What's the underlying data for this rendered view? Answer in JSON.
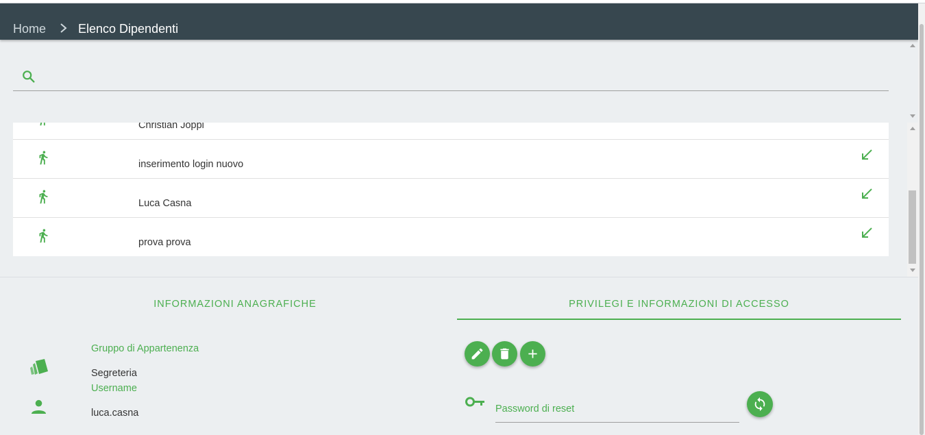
{
  "breadcrumb": {
    "home": "Home",
    "current": "Elenco Dipendenti"
  },
  "search": {
    "placeholder": ""
  },
  "employees": [
    {
      "name": "Christian Joppi"
    },
    {
      "name": "inserimento login nuovo"
    },
    {
      "name": "Luca Casna"
    },
    {
      "name": "prova prova"
    }
  ],
  "tabs": {
    "personal": "INFORMAZIONI ANAGRAFICHE",
    "access": "PRIVILEGI E INFORMAZIONI DI ACCESSO"
  },
  "details": {
    "group_label": "Gruppo di Appartenenza",
    "group_value": "Segreteria",
    "username_label": "Username",
    "username_value": "luca.casna"
  },
  "access": {
    "password_placeholder": "Password di reset"
  },
  "icons": {
    "search": "search-icon",
    "walk": "walk-icon",
    "go": "arrow-down-left-icon",
    "group": "tags-icon",
    "user": "person-icon",
    "edit": "pencil-icon",
    "delete": "trash-icon",
    "add": "plus-icon",
    "key": "key-icon",
    "reset": "refresh-icon"
  },
  "colors": {
    "header": "#37474f",
    "accent": "#4caf50",
    "background": "#eceff1"
  }
}
